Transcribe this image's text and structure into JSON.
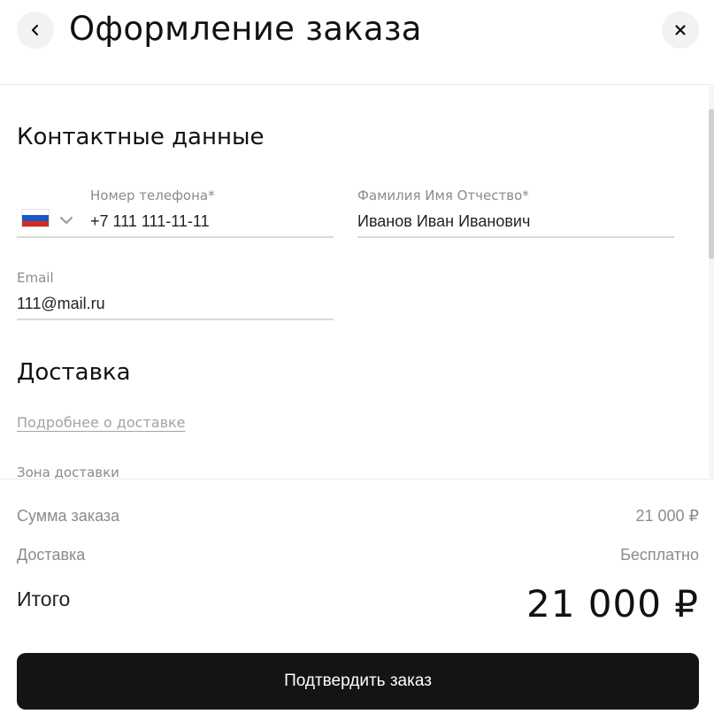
{
  "header": {
    "title": "Оформление заказа",
    "back_icon": "chevron-left-icon",
    "close_icon": "close-icon"
  },
  "contact": {
    "section_title": "Контактные данные",
    "phone": {
      "label": "Номер телефона*",
      "value": "+7 111 111-11-11",
      "country_flag": "russia-flag-icon"
    },
    "full_name": {
      "label": "Фамилия Имя Отчество*",
      "value": "Иванов Иван Иванович"
    },
    "email": {
      "label": "Email",
      "value": "111@mail.ru"
    }
  },
  "delivery": {
    "section_title": "Доставка",
    "more_link": "Подробнее о доставке",
    "zone_label": "Зона доставки"
  },
  "summary": {
    "order_sum_label": "Сумма заказа",
    "order_sum_value": "21 000 ₽",
    "delivery_label": "Доставка",
    "delivery_value": "Бесплатно",
    "total_label": "Итого",
    "total_value": "21 000 ₽",
    "confirm_button": "Подтвердить заказ"
  },
  "colors": {
    "primary_button": "#141414",
    "muted_text": "#8b8b8b",
    "link_text": "#a3a3a3",
    "flag_white": "#ffffff",
    "flag_blue": "#1c57c9",
    "flag_red": "#d52b1e"
  }
}
